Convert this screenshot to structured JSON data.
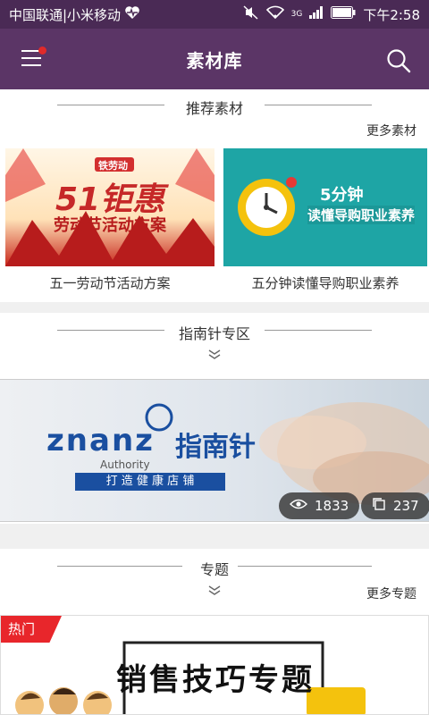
{
  "status_bar": {
    "carrier": "中国联通|小米移动",
    "network": "3G",
    "time": "下午2:58"
  },
  "app_bar": {
    "title": "素材库",
    "menu_icon": "hamburger-menu-icon",
    "search_icon": "search-icon"
  },
  "recommended": {
    "title": "推荐素材",
    "more_label": "更多素材",
    "items": [
      {
        "label": "五一劳动节活动方案",
        "art_badge": "铁劳动",
        "art_big": "51钜惠",
        "art_sub": "劳动节活动方案"
      },
      {
        "label": "五分钟读懂导购职业素养",
        "art_top": "5分钟",
        "art_main": "读懂导购职业素养"
      }
    ]
  },
  "guide": {
    "title": "指南针专区",
    "banner": {
      "brand": "znanz",
      "brand_cn": "指南针",
      "brand_sub": "Authority",
      "slogan": "打 造 健 康 店 铺",
      "views": "1833",
      "copies": "237"
    }
  },
  "topics": {
    "title": "专题",
    "more_label": "更多专题",
    "hot_label": "热门",
    "banner_title": "销售技巧专题"
  },
  "colors": {
    "appbar": "#5b3566",
    "statusbar": "#4a2a55",
    "hot": "#e8262b"
  }
}
